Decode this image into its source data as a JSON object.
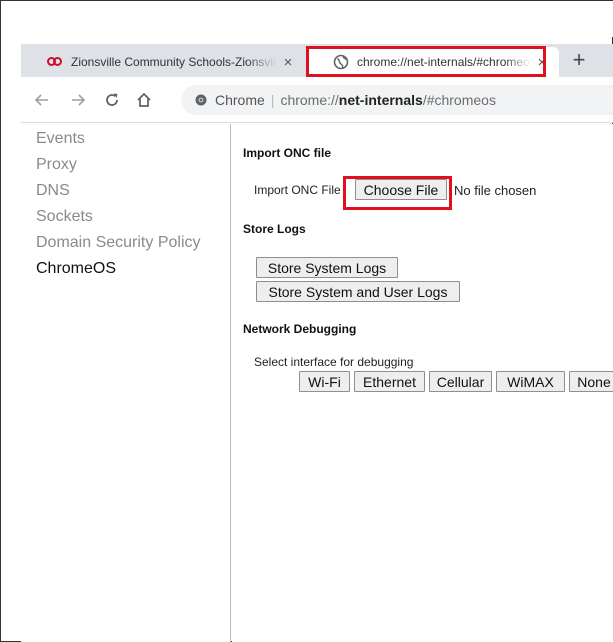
{
  "tabs": [
    {
      "title": "Zionsville Community Schools-Zionsville Community Schools",
      "close": "×",
      "active": false
    },
    {
      "title": "chrome://net-internals/#chromeos",
      "close": "×",
      "active": true
    }
  ],
  "new_tab": "+",
  "toolbar": {
    "back": "back",
    "forward": "forward",
    "reload": "reload",
    "home": "home",
    "chip_label": "Chrome",
    "separator": "|",
    "url_scheme": "chrome://",
    "url_host": "net-internals",
    "url_path": "/#chromeos"
  },
  "sidebar": {
    "items": [
      {
        "label": "Events",
        "active": false
      },
      {
        "label": "Proxy",
        "active": false
      },
      {
        "label": "DNS",
        "active": false
      },
      {
        "label": "Sockets",
        "active": false
      },
      {
        "label": "Domain Security Policy",
        "active": false
      },
      {
        "label": "ChromeOS",
        "active": true
      }
    ]
  },
  "main": {
    "import_onc": {
      "title": "Import ONC file",
      "label": "Import ONC File",
      "button": "Choose File",
      "status": "No file chosen"
    },
    "store_logs": {
      "title": "Store Logs",
      "btn_system": "Store System Logs",
      "btn_system_user": "Store System and User Logs"
    },
    "network_debugging": {
      "title": "Network Debugging",
      "label": "Select interface for debugging",
      "interfaces": [
        "Wi-Fi",
        "Ethernet",
        "Cellular",
        "WiMAX",
        "None"
      ]
    }
  },
  "colors": {
    "highlight": "#e0101e",
    "tabstrip": "#dee1e6",
    "omnibox": "#f1f3f4"
  }
}
